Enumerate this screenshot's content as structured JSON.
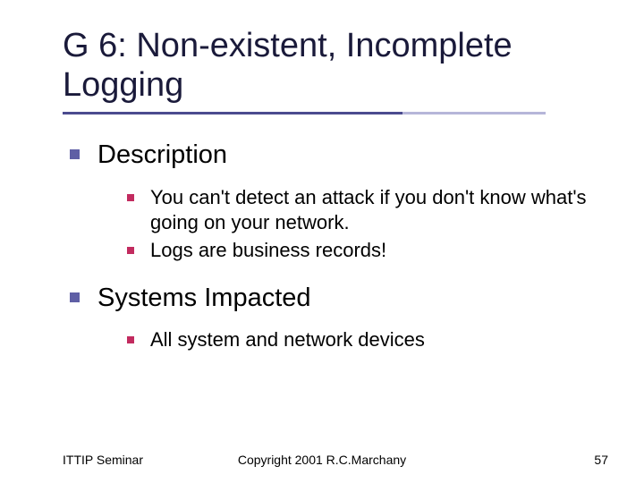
{
  "title": "G 6: Non-existent, Incomplete Logging",
  "sections": [
    {
      "heading": "Description",
      "items": [
        "You can't detect an attack if you don't know what's going on your network.",
        "Logs are business records!"
      ]
    },
    {
      "heading": "Systems Impacted",
      "items": [
        "All system and network devices"
      ]
    }
  ],
  "footer": {
    "left": "ITTIP Seminar",
    "center": "Copyright 2001 R.C.Marchany",
    "right": "57"
  },
  "colors": {
    "title": "#1a1a3a",
    "bullet1": "#5f5fa5",
    "bullet2": "#c22b5f",
    "underline_dark": "#4b4b8f",
    "underline_light": "#b6b6d9"
  }
}
